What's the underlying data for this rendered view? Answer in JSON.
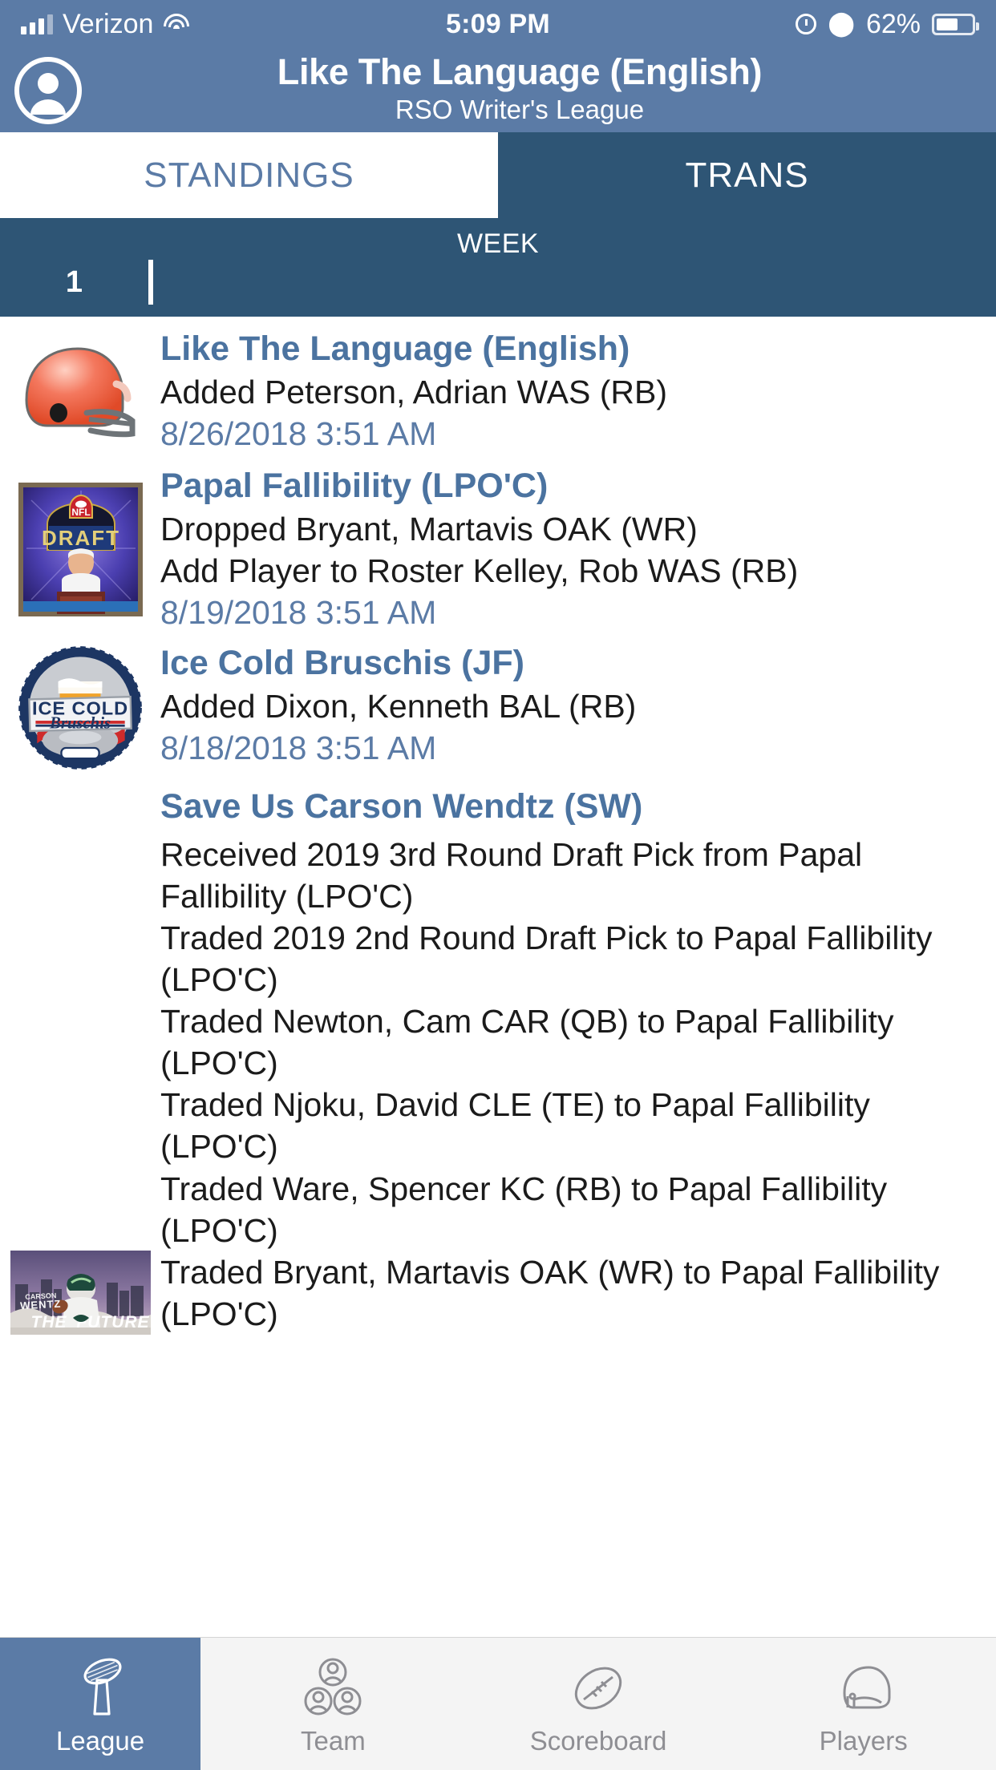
{
  "status_bar": {
    "carrier": "Verizon",
    "time": "5:09 PM",
    "battery_pct": "62%",
    "icons": [
      "signal-bars-icon",
      "wifi-icon",
      "alarm-icon",
      "bluetooth-icon",
      "battery-icon"
    ]
  },
  "nav": {
    "title": "Like The Language (English)",
    "subtitle": "RSO Writer's League",
    "avatar_icon": "user-avatar-icon"
  },
  "segments": [
    {
      "label": "STANDINGS",
      "active": false
    },
    {
      "label": "TRANS",
      "active": true
    }
  ],
  "week_selector": {
    "label": "WEEK",
    "selected": "1"
  },
  "transactions": [
    {
      "team": "Like The Language (English)",
      "avatar": "orange-football-helmet-logo",
      "lines": [
        "Added Peterson, Adrian WAS  (RB)"
      ],
      "date": "8/26/2018 3:51 AM"
    },
    {
      "team": "Papal Fallibility (LPO'C)",
      "avatar": "nfl-draft-pope-podium-photo",
      "lines": [
        "Dropped Bryant, Martavis OAK  (WR)",
        "Add Player to Roster Kelley, Rob WAS  (RB)"
      ],
      "date": "8/19/2018 3:51 AM"
    },
    {
      "team": "Ice Cold Bruschis (JF)",
      "avatar": "ice-cold-bruschis-bottlecap-logo",
      "lines": [
        "Added Dixon, Kenneth BAL  (RB)"
      ],
      "date": "8/18/2018 3:51 AM"
    },
    {
      "team": "Save Us Carson Wendtz (SW)",
      "avatar": "carson-wentz-the-future-photo",
      "lines": [
        "Received 2019 3rd Round Draft Pick from Papal Fallibility (LPO'C)",
        "Traded 2019 2nd Round Draft Pick to Papal Fallibility (LPO'C)",
        "Traded Newton, Cam CAR  (QB) to Papal Fallibility (LPO'C)",
        "Traded Njoku, David CLE  (TE) to Papal Fallibility (LPO'C)",
        "Traded Ware, Spencer KC   (RB) to Papal Fallibility (LPO'C)",
        "Traded Bryant, Martavis OAK  (WR) to Papal Fallibility (LPO'C)"
      ],
      "date": ""
    }
  ],
  "tabbar": [
    {
      "label": "League",
      "icon": "trophy-icon",
      "active": true
    },
    {
      "label": "Team",
      "icon": "people-group-icon",
      "active": false
    },
    {
      "label": "Scoreboard",
      "icon": "football-icon",
      "active": false
    },
    {
      "label": "Players",
      "icon": "helmet-icon",
      "active": false
    }
  ],
  "colors": {
    "header_blue": "#5b7ba6",
    "dark_blue": "#2e5575",
    "link_blue": "#4b73a0",
    "date_blue": "#5b7ba6",
    "tab_inactive": "#8e8e93"
  }
}
